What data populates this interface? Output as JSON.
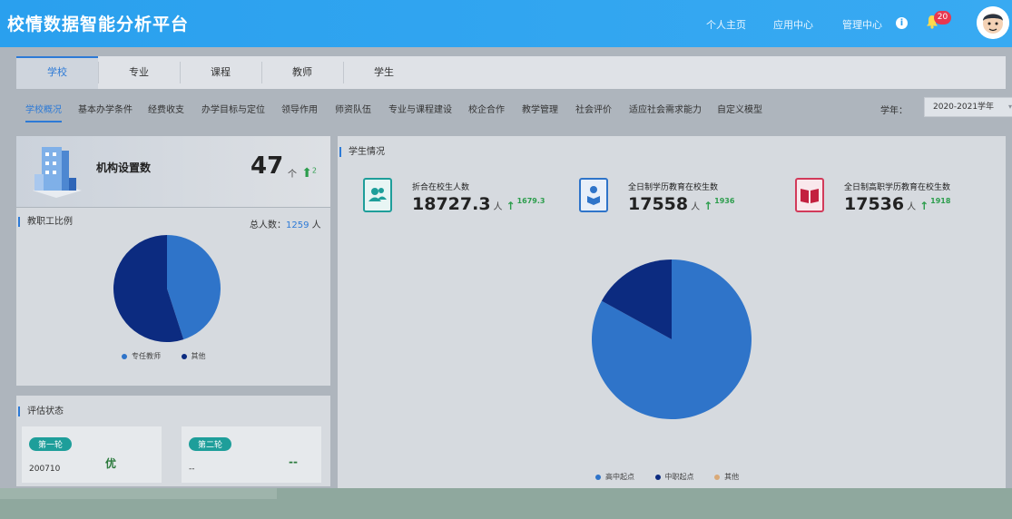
{
  "header": {
    "app_title": "校情数据智能分析平台",
    "nav": [
      "个人主页",
      "应用中心",
      "管理中心"
    ],
    "notification_count": "20",
    "info_icon": "info-icon",
    "bell_icon": "bell-icon"
  },
  "main_tabs": [
    "学校",
    "专业",
    "课程",
    "教师",
    "学生"
  ],
  "sub_nav": [
    "学校概况",
    "基本办学条件",
    "经费收支",
    "办学目标与定位",
    "领导作用",
    "师资队伍",
    "专业与课程建设",
    "校企合作",
    "教学管理",
    "社会评价",
    "适应社会需求能力",
    "自定义模型"
  ],
  "year": {
    "label": "学年：",
    "value": "2020-2021学年"
  },
  "org": {
    "label": "机构设置数",
    "value": "47",
    "unit": "个",
    "delta": "2"
  },
  "staff_ratio": {
    "title": "教职工比例",
    "total_label": "总人数：",
    "total_value": "1259",
    "total_unit": "人",
    "legend": [
      "专任教师",
      "其他"
    ]
  },
  "evaluation": {
    "title": "评估状态",
    "rounds": [
      {
        "tag": "第一轮",
        "code": "200710",
        "grade": "优"
      },
      {
        "tag": "第二轮",
        "code": "--",
        "grade": "--"
      }
    ]
  },
  "students": {
    "title": "学生情况",
    "stats": [
      {
        "label": "折合在校生人数",
        "value": "18727.3",
        "unit": "人",
        "delta": "1679.3"
      },
      {
        "label": "全日制学历教育在校生数",
        "value": "17558",
        "unit": "人",
        "delta": "1936"
      },
      {
        "label": "全日制高职学历教育在校生数",
        "value": "17536",
        "unit": "人",
        "delta": "1918"
      }
    ],
    "legend": [
      "高中起点",
      "中职起点",
      "其他"
    ]
  },
  "chart_data": [
    {
      "type": "pie",
      "categories": [
        "专任教师",
        "其他"
      ],
      "values": [
        45,
        55
      ],
      "colors": [
        "#2f74c9",
        "#0c2b80"
      ]
    },
    {
      "type": "pie",
      "categories": [
        "高中起点",
        "中职起点",
        "其他"
      ],
      "values": [
        83,
        17,
        0
      ],
      "colors": [
        "#2f74c9",
        "#0c2b80",
        "#d9a978"
      ]
    }
  ],
  "colors": {
    "accent": "#2d7ad6",
    "topbar": "#2aa0ee",
    "up": "#2c9d4c",
    "teal": "#1e9e9a"
  }
}
